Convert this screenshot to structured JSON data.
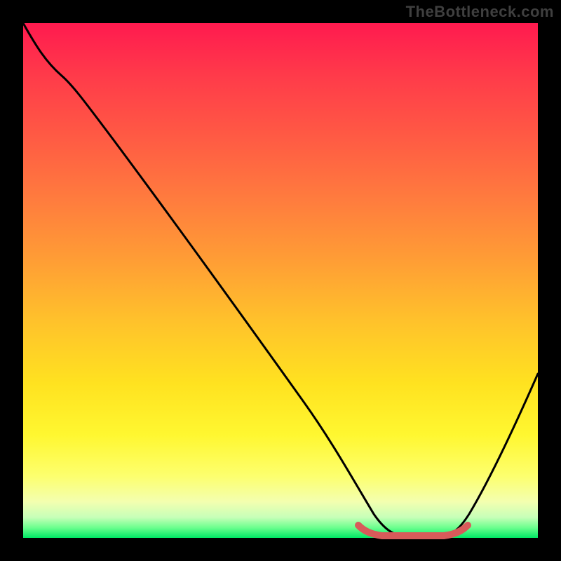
{
  "watermark": "TheBottleneck.com",
  "chart_data": {
    "type": "line",
    "title": "",
    "xlabel": "",
    "ylabel": "",
    "xlim": [
      0,
      100
    ],
    "ylim": [
      0,
      100
    ],
    "series": [
      {
        "name": "bottleneck-curve",
        "x": [
          0,
          4,
          8,
          12,
          18,
          30,
          45,
          55,
          60,
          64,
          68,
          74,
          78,
          82,
          86,
          92,
          100
        ],
        "values": [
          100,
          95,
          91,
          89,
          83,
          67,
          47,
          33,
          23,
          13,
          5,
          0,
          0,
          0,
          5,
          18,
          45
        ]
      },
      {
        "name": "optimal-range-marker",
        "x": [
          64,
          66,
          70,
          74,
          78,
          82,
          84,
          86
        ],
        "values": [
          2.2,
          1.0,
          0.3,
          0.0,
          0.0,
          0.3,
          1.0,
          2.2
        ]
      }
    ],
    "colors": {
      "curve": "#000000",
      "marker": "#d85a5a",
      "gradient_top": "#ff1a4f",
      "gradient_bottom": "#00e865"
    }
  }
}
